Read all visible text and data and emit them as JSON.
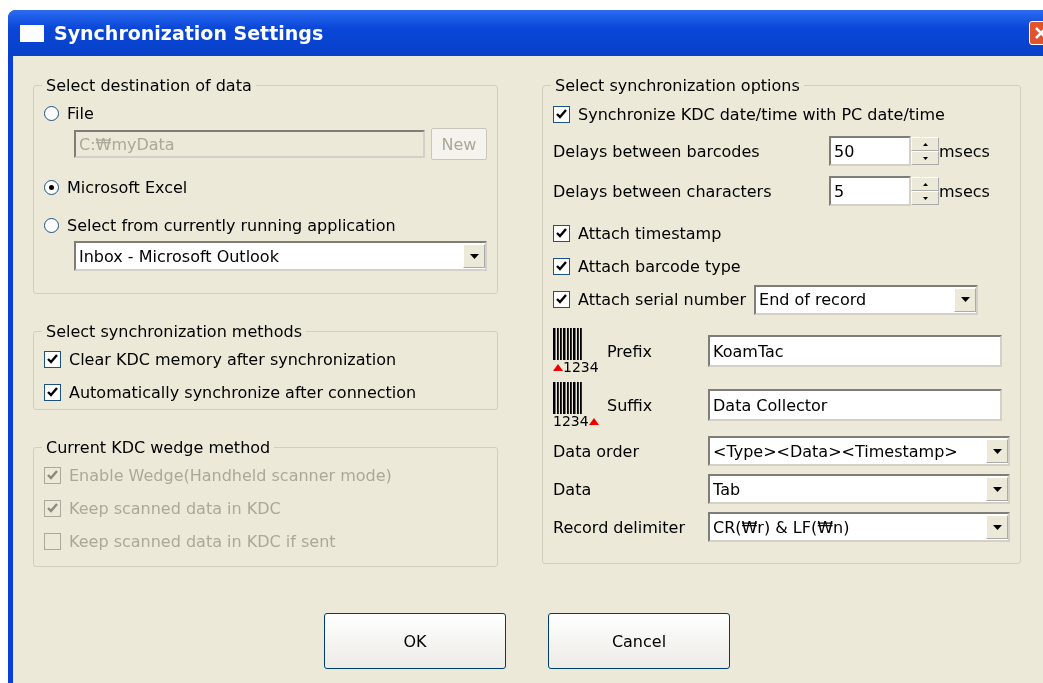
{
  "window": {
    "title": "Synchronization Settings"
  },
  "destination": {
    "title": "Select destination of data",
    "options": [
      {
        "label": "File",
        "selected": false
      },
      {
        "label": "Microsoft Excel",
        "selected": true
      },
      {
        "label": "Select from currently running application",
        "selected": false
      }
    ],
    "file_path": {
      "value": "C:₩myData",
      "disabled": true
    },
    "new_button": {
      "label": "New",
      "disabled": true
    },
    "application": {
      "value": "Inbox - Microsoft Outlook"
    }
  },
  "methods": {
    "title": "Select synchronization methods",
    "items": [
      {
        "label": "Clear KDC memory after synchronization",
        "checked": true,
        "disabled": false
      },
      {
        "label": "Automatically synchronize after connection",
        "checked": true,
        "disabled": false
      }
    ]
  },
  "wedge": {
    "title": "Current KDC wedge method",
    "items": [
      {
        "label": "Enable Wedge(Handheld scanner mode)",
        "checked": true,
        "disabled": true
      },
      {
        "label": "Keep scanned data in KDC",
        "checked": true,
        "disabled": true
      },
      {
        "label": "Keep scanned data in KDC if sent",
        "checked": false,
        "disabled": true
      }
    ]
  },
  "options": {
    "title": "Select synchronization options",
    "sync_time": {
      "label": "Synchronize KDC date/time with PC date/time",
      "checked": true
    },
    "delays": [
      {
        "label": "Delays between barcodes",
        "value": "50",
        "unit": "msecs"
      },
      {
        "label": "Delays between characters",
        "value": "5",
        "unit": "msecs"
      }
    ],
    "attach": [
      {
        "label": "Attach timestamp",
        "checked": true
      },
      {
        "label": "Attach barcode type",
        "checked": true
      },
      {
        "label": "Attach serial number",
        "checked": true,
        "dropdown": "End of record"
      }
    ],
    "affixes": [
      {
        "label": "Prefix",
        "value": "KoamTac",
        "caption": "1234",
        "kind": "prefix"
      },
      {
        "label": "Suffix",
        "value": "Data Collector",
        "caption": "1234",
        "kind": "suffix"
      }
    ],
    "selects": [
      {
        "label": "Data order",
        "value": "<Type><Data><Timestamp>"
      },
      {
        "label": "Data",
        "value": "Tab"
      },
      {
        "label": "Record delimiter",
        "value": "CR(₩r) & LF(₩n)"
      }
    ]
  },
  "buttons": [
    {
      "label": "OK"
    },
    {
      "label": "Cancel"
    }
  ]
}
